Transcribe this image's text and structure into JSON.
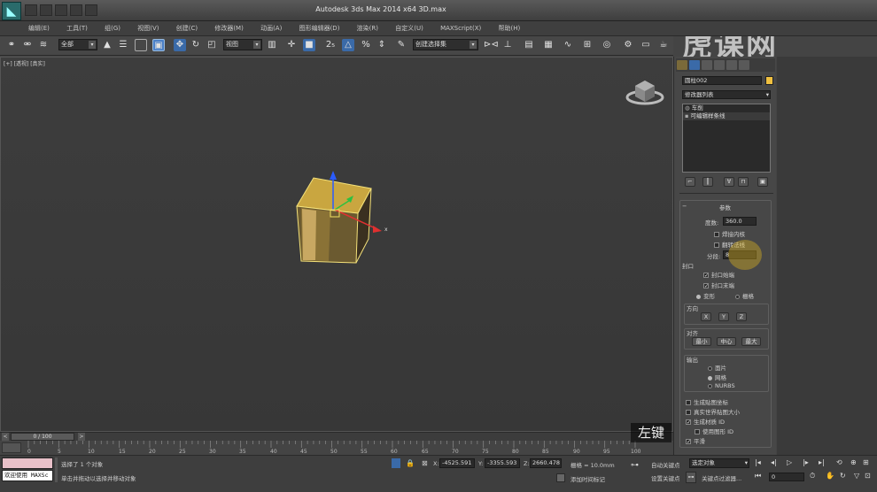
{
  "window": {
    "title": "Autodesk 3ds Max  2014 x64      3D.max"
  },
  "brand": {
    "text": "虎课网"
  },
  "menu": [
    "编辑(E)",
    "工具(T)",
    "组(G)",
    "视图(V)",
    "创建(C)",
    "修改器(M)",
    "动画(A)",
    "图形编辑器(D)",
    "渲染(R)",
    "自定义(U)",
    "MAXScript(X)",
    "帮助(H)"
  ],
  "toolbar": {
    "filter": "全部",
    "refcoord": "视图",
    "named_selection": "创建选择集"
  },
  "viewport": {
    "label": "[+] [透视] [真实]"
  },
  "gizmo": {
    "axis_x": "x"
  },
  "panel": {
    "object_name": "圆柱002",
    "modifier_list": "修改器列表",
    "stack": [
      "车削",
      "可编辑样条线"
    ],
    "rollout_title": "参数",
    "degrees_label": "度数:",
    "degrees_value": "360.0",
    "weld_core": "焊接内核",
    "flip_normals": "翻转法线",
    "segments_label": "分段:",
    "segments_value": "8",
    "capping_title": "封口",
    "cap_start": "封口始端",
    "cap_end": "封口末端",
    "morph": "变形",
    "grid": "栅格",
    "direction_title": "方向",
    "dir_x": "X",
    "dir_y": "Y",
    "dir_z": "Z",
    "align_title": "对齐",
    "align_min": "最小",
    "align_center": "中心",
    "align_max": "最大",
    "output_title": "输出",
    "out_patch": "面片",
    "out_mesh": "网格",
    "out_nurbs": "NURBS",
    "gen_mapping": "生成贴图坐标",
    "real_world": "真实世界贴图大小",
    "gen_matids": "生成材质 ID",
    "use_shape_ids": "使用图形 ID",
    "smooth": "平滑"
  },
  "timeline": {
    "frame": "0 / 100",
    "ticks": [
      "0",
      "5",
      "10",
      "15",
      "20",
      "25",
      "30",
      "35",
      "40",
      "45",
      "50",
      "55",
      "60",
      "65",
      "70",
      "75",
      "80",
      "85",
      "90",
      "95",
      "100"
    ]
  },
  "status": {
    "maxscript": "欢迎使用 MAXSc",
    "selected": "选择了 1 个对象",
    "prompt": "单击并拖动以选择并移动对象",
    "x_label": "X:",
    "x_value": "-4525.591",
    "y_label": "Y:",
    "y_value": "-3355.593",
    "z_label": "Z:",
    "z_value": "2660.478",
    "grid": "栅格 = 10.0mm",
    "add_time_tag": "添加时间标记",
    "auto_key": "自动关键点",
    "selected_object": "选定对象",
    "set_key": "设置关键点",
    "key_filters": "关键点过滤器...",
    "frame_field": "0"
  },
  "hint": {
    "text": "左键"
  },
  "colors": {
    "accent": "#f0c040",
    "highlight": "#f5c518",
    "object": "#c9a640"
  }
}
